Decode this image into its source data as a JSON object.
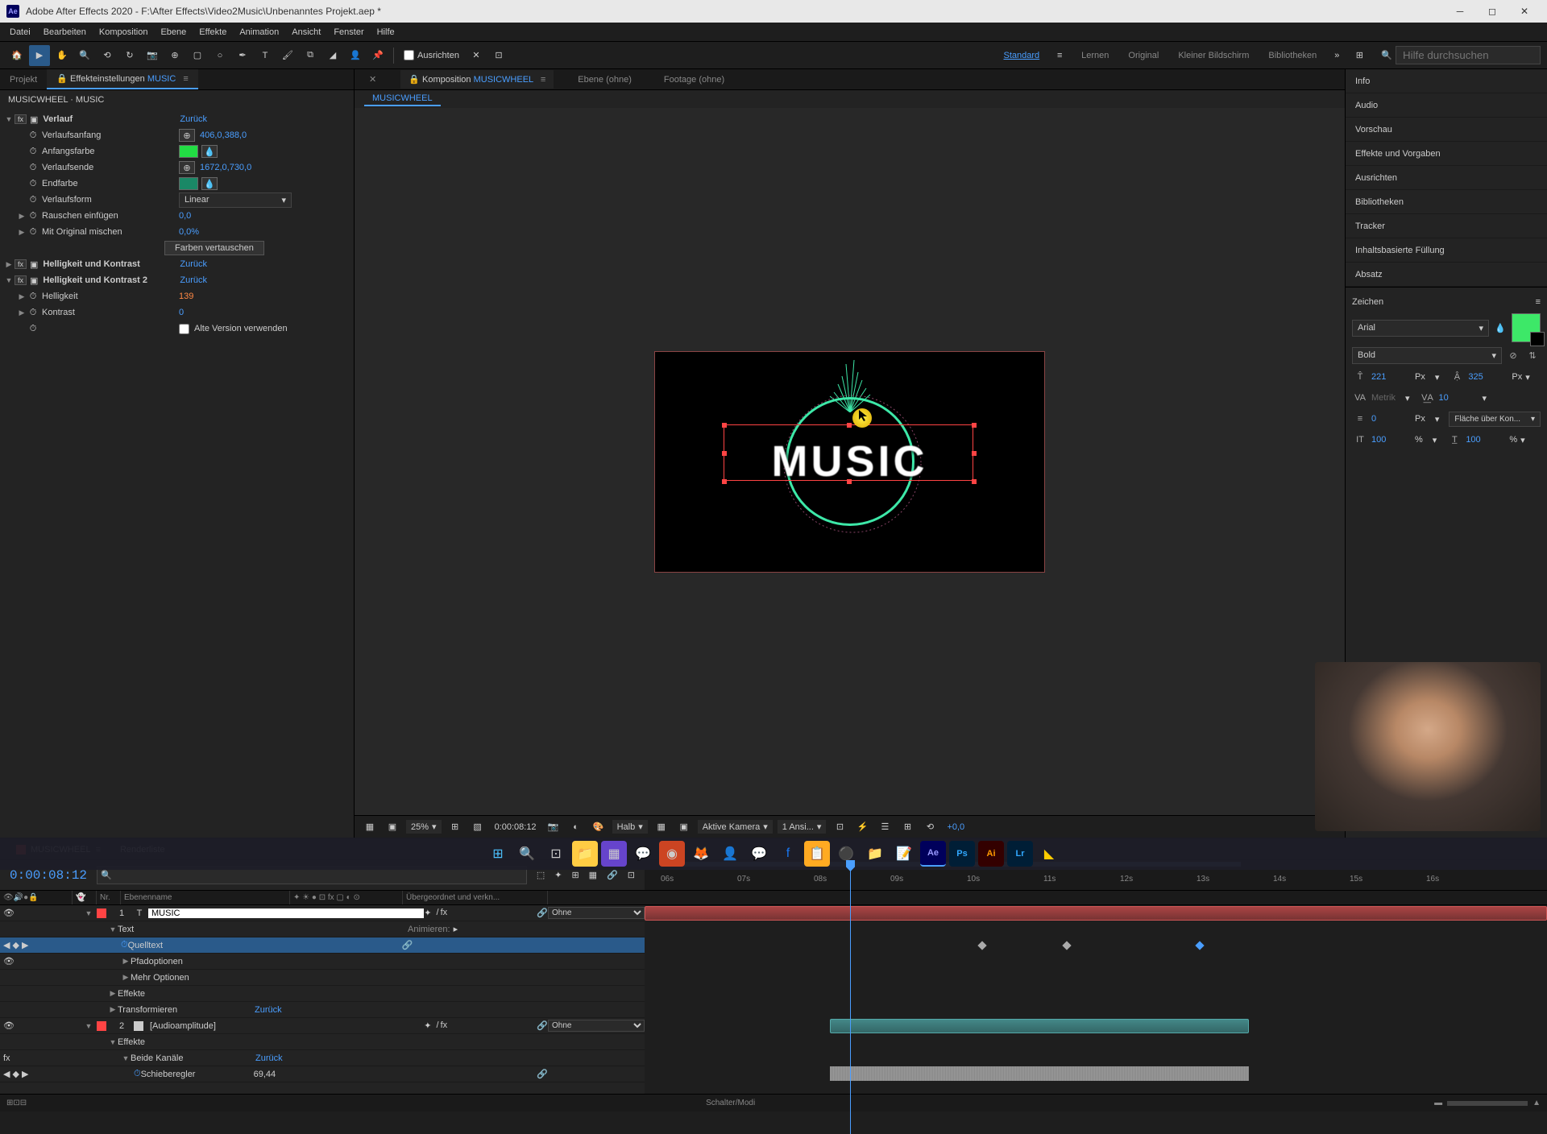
{
  "titlebar": {
    "app": "Adobe After Effects 2020",
    "path": "F:\\After Effects\\Video2Music\\Unbenanntes Projekt.aep *"
  },
  "menu": [
    "Datei",
    "Bearbeiten",
    "Komposition",
    "Ebene",
    "Effekte",
    "Animation",
    "Ansicht",
    "Fenster",
    "Hilfe"
  ],
  "toolbar": {
    "align_label": "Ausrichten",
    "workspaces": [
      "Standard",
      "Lernen",
      "Original",
      "Kleiner Bildschirm",
      "Bibliotheken"
    ],
    "active_workspace": 0,
    "search_placeholder": "Hilfe durchsuchen"
  },
  "effect_controls": {
    "tab_project": "Projekt",
    "tab_effects": "Effekteinstellungen",
    "active_layer": "MUSIC",
    "breadcrumb": "MUSICWHEEL · MUSIC",
    "effects": [
      {
        "name": "Verlauf",
        "reset": "Zurück",
        "props": [
          {
            "label": "Verlaufsanfang",
            "value": "406,0,388,0",
            "hasTarget": true
          },
          {
            "label": "Anfangsfarbe",
            "color": "#22dd44",
            "eyedropper": true
          },
          {
            "label": "Verlaufsende",
            "value": "1672,0,730,0",
            "hasTarget": true
          },
          {
            "label": "Endfarbe",
            "color": "#1a8866",
            "eyedropper": true
          },
          {
            "label": "Verlaufsform",
            "dropdown": "Linear"
          },
          {
            "label": "Rauschen einfügen",
            "value": "0,0",
            "twirl": true
          },
          {
            "label": "Mit Original mischen",
            "value": "0,0%",
            "twirl": true
          },
          {
            "button": "Farben vertauschen"
          }
        ]
      },
      {
        "name": "Helligkeit und Kontrast",
        "reset": "Zurück"
      },
      {
        "name": "Helligkeit und Kontrast 2",
        "reset": "Zurück",
        "props": [
          {
            "label": "Helligkeit",
            "value": "139",
            "orange": true,
            "twirl": true
          },
          {
            "label": "Kontrast",
            "value": "0",
            "twirl": true
          },
          {
            "checkbox": "Alte Version verwenden"
          }
        ]
      }
    ]
  },
  "composition": {
    "tab_comp_prefix": "Komposition",
    "tab_comp_name": "MUSICWHEEL",
    "tab_layer": "Ebene (ohne)",
    "tab_footage": "Footage (ohne)",
    "subtab": "MUSICWHEEL",
    "preview_text": "MUSIC"
  },
  "viewer_controls": {
    "zoom": "25%",
    "timecode": "0:00:08:12",
    "resolution": "Halb",
    "camera": "Aktive Kamera",
    "views": "1 Ansi...",
    "exposure": "+0,0"
  },
  "right_panels": [
    "Info",
    "Audio",
    "Vorschau",
    "Effekte und Vorgaben",
    "Ausrichten",
    "Bibliotheken",
    "Tracker",
    "Inhaltsbasierte Füllung",
    "Absatz"
  ],
  "character": {
    "title": "Zeichen",
    "font": "Arial",
    "style": "Bold",
    "size": "221",
    "size_unit": "Px",
    "leading": "325",
    "leading_unit": "Px",
    "kerning": "Metrik",
    "tracking": "10",
    "stroke": "0",
    "stroke_unit": "Px",
    "fill_over": "Fläche über Kon...",
    "vscale": "100",
    "hscale": "100",
    "pct": "%"
  },
  "timeline": {
    "tab_name": "MUSICWHEEL",
    "tab_render": "Renderliste",
    "timecode": "0:00:08:12",
    "col_nr": "Nr.",
    "col_name": "Ebenenname",
    "col_parent": "Übergeordnet und verkn...",
    "ticks": [
      "06s",
      "07s",
      "08s",
      "09s",
      "10s",
      "11s",
      "12s",
      "13s",
      "14s",
      "15s",
      "16s"
    ],
    "layers": [
      {
        "num": "1",
        "name": "MUSIC",
        "color": "#ff4444",
        "type": "T",
        "parent": "Ohne",
        "selected": true,
        "props": [
          {
            "label": "Text",
            "extra": "Animieren:",
            "indent": 1
          },
          {
            "label": "Quelltext",
            "selected": true,
            "indent": 2,
            "stopwatch": true
          },
          {
            "label": "Pfadoptionen",
            "indent": 2
          },
          {
            "label": "Mehr Optionen",
            "indent": 2
          },
          {
            "label": "Effekte",
            "indent": 1
          },
          {
            "label": "Transformieren",
            "reset": "Zurück",
            "indent": 1
          }
        ]
      },
      {
        "num": "2",
        "name": "[Audioamplitude]",
        "color": "#ff4444",
        "type": "solid",
        "parent": "Ohne",
        "props": [
          {
            "label": "Effekte",
            "indent": 1
          },
          {
            "label": "Beide Kanäle",
            "reset": "Zurück",
            "indent": 2
          },
          {
            "label": "Schieberegler",
            "value": "69,44",
            "orange": true,
            "indent": 3
          }
        ]
      }
    ],
    "footer": "Schalter/Modi"
  }
}
